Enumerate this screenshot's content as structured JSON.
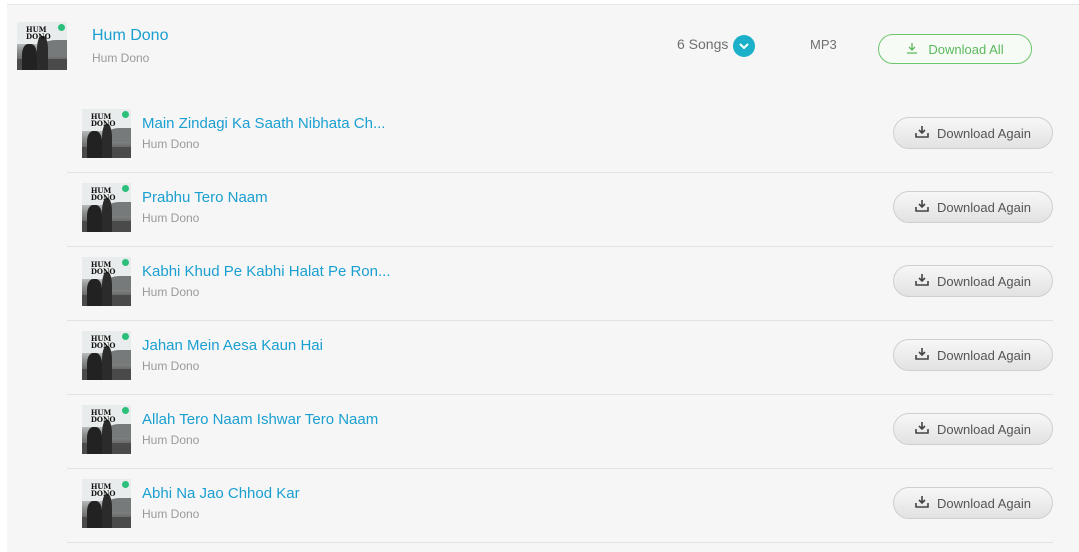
{
  "album": {
    "title": "Hum Dono",
    "subtitle": "Hum Dono",
    "songs_count": "6 Songs",
    "format": "MP3",
    "download_all_label": "Download All",
    "thumb_text": "HUM DONO"
  },
  "songs": [
    {
      "title": "Main Zindagi Ka Saath Nibhata Ch...",
      "album": "Hum Dono",
      "button": "Download Again"
    },
    {
      "title": "Prabhu Tero Naam",
      "album": "Hum Dono",
      "button": "Download Again"
    },
    {
      "title": "Kabhi Khud Pe Kabhi Halat Pe Ron...",
      "album": "Hum Dono",
      "button": "Download Again"
    },
    {
      "title": "Jahan Mein Aesa Kaun Hai",
      "album": "Hum Dono",
      "button": "Download Again"
    },
    {
      "title": "Allah Tero Naam Ishwar Tero Naam",
      "album": "Hum Dono",
      "button": "Download Again"
    },
    {
      "title": "Abhi Na Jao Chhod Kar",
      "album": "Hum Dono",
      "button": "Download Again"
    }
  ],
  "colors": {
    "link": "#1a9fd1",
    "accent_green": "#5cb85c",
    "chevron_bg": "#1ab0c9"
  },
  "icons": {
    "chevron": "chevron-down-icon",
    "download": "download-icon",
    "download_again": "download-tray-icon"
  }
}
